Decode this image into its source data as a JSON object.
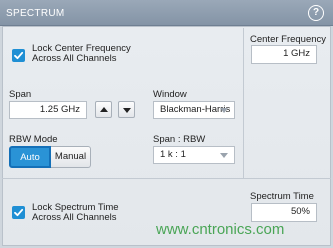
{
  "header": {
    "title": "SPECTRUM",
    "help_icon": "help-circle-icon",
    "help_glyph": "?"
  },
  "lock_center": {
    "checked": true,
    "line1": "Lock Center Frequency",
    "line2": "Across All Channels"
  },
  "center_frequency": {
    "label": "Center Frequency",
    "value": "1 GHz"
  },
  "span": {
    "label": "Span",
    "value": "1.25 GHz",
    "up_icon": "triangle-up-icon",
    "down_icon": "triangle-down-icon"
  },
  "window": {
    "label": "Window",
    "selected": "Blackman-Harris"
  },
  "rbw_mode": {
    "label": "RBW Mode",
    "options": [
      "Auto",
      "Manual"
    ],
    "selected": "Auto"
  },
  "span_rbw": {
    "label": "Span : RBW",
    "selected": "1 k : 1"
  },
  "lock_spectrum_time": {
    "checked": true,
    "line1": "Lock Spectrum Time",
    "line2": "Across All Channels"
  },
  "spectrum_time": {
    "label": "Spectrum Time",
    "value": "50%"
  },
  "watermark": "www.cntronics.com",
  "colors": {
    "accent": "#1f8fd4",
    "titlebar": "#8d9cae",
    "panel": "#e6eaee",
    "watermark": "#2f9a3c"
  }
}
